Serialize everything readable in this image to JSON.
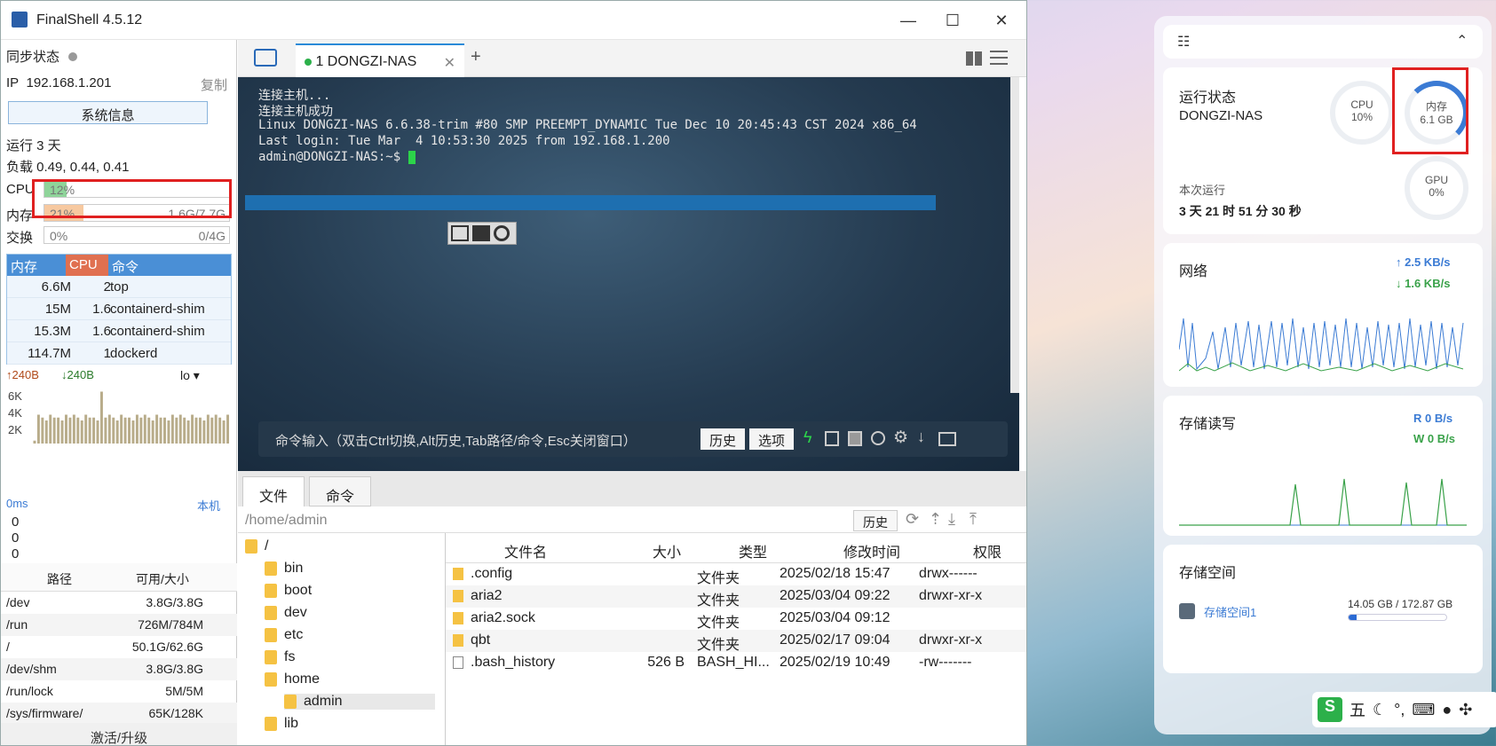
{
  "app": {
    "title": "FinalShell 4.5.12",
    "win_minimize": "—",
    "win_maximize": "☐",
    "win_close": "✕"
  },
  "left": {
    "sync_label": "同步状态",
    "ip_label": "IP",
    "ip": "192.168.1.201",
    "copy": "复制",
    "sysinfo_button": "系统信息",
    "uptime": "运行 3 天",
    "load": "负载 0.49, 0.44, 0.41",
    "cpu_label": "CPU",
    "cpu_pct": "12%",
    "cpu_fraction": 0.12,
    "mem_label": "内存",
    "mem_pct": "21%",
    "mem_fraction": 0.21,
    "mem_val": "1.6G/7.7G",
    "swap_label": "交换",
    "swap_pct": "0%",
    "swap_val": "0/4G",
    "proc_headers": {
      "mem": "内存",
      "cpu": "CPU",
      "cmd": "命令"
    },
    "processes": [
      {
        "mem": "6.6M",
        "cpu": "2",
        "cmd": "top"
      },
      {
        "mem": "15M",
        "cpu": "1.6",
        "cmd": "containerd-shim"
      },
      {
        "mem": "15.3M",
        "cpu": "1.6",
        "cmd": "containerd-shim"
      },
      {
        "mem": "114.7M",
        "cpu": "1",
        "cmd": "dockerd"
      }
    ],
    "net_up": "240B",
    "net_down": "240B",
    "net_iface": "lo",
    "net_axis": [
      "6K",
      "4K",
      "2K"
    ],
    "net_bars": [
      0.05,
      0.5,
      0.45,
      0.4,
      0.5,
      0.45,
      0.45,
      0.4,
      0.5,
      0.45,
      0.5,
      0.45,
      0.4,
      0.5,
      0.45,
      0.45,
      0.4,
      0.9,
      0.45,
      0.5,
      0.45,
      0.4,
      0.5,
      0.45,
      0.45,
      0.4,
      0.5,
      0.45,
      0.5,
      0.45,
      0.4,
      0.5,
      0.45,
      0.45,
      0.4,
      0.5,
      0.45,
      0.5,
      0.45,
      0.4,
      0.5,
      0.45,
      0.45,
      0.4,
      0.5,
      0.45,
      0.5,
      0.45,
      0.4,
      0.5
    ],
    "ping_label": "0ms",
    "ping_host": "本机",
    "ping_vals": [
      "0",
      "0",
      "0"
    ],
    "disk_headers": {
      "path": "路径",
      "avail": "可用/大小"
    },
    "disks": [
      {
        "path": "/dev",
        "size": "3.8G/3.8G"
      },
      {
        "path": "/run",
        "size": "726M/784M"
      },
      {
        "path": "/",
        "size": "50.1G/62.6G"
      },
      {
        "path": "/dev/shm",
        "size": "3.8G/3.8G"
      },
      {
        "path": "/run/lock",
        "size": "5M/5M"
      },
      {
        "path": "/sys/firmware/",
        "size": "65K/128K"
      }
    ],
    "activate": "激活/升级"
  },
  "tabs": {
    "session": "1 DONGZI-NAS",
    "add": "+"
  },
  "terminal": {
    "lines": [
      "连接主机...",
      "连接主机成功",
      "Linux DONGZI-NAS 6.6.38-trim #80 SMP PREEMPT_DYNAMIC Tue Dec 10 20:45:43 CST 2024 x86_64",
      "Last login: Tue Mar  4 10:53:30 2025 from 192.168.1.200",
      "admin@DONGZI-NAS:~$ "
    ],
    "cmd_hint": "命令输入（双击Ctrl切换,Alt历史,Tab路径/命令,Esc关闭窗口）",
    "history_btn": "历史",
    "options_btn": "选项"
  },
  "files": {
    "tab_files": "文件",
    "tab_cmds": "命令",
    "path": "/home/admin",
    "history_btn": "历史",
    "tree": [
      {
        "name": "/",
        "level": 0
      },
      {
        "name": "bin",
        "level": 1
      },
      {
        "name": "boot",
        "level": 1
      },
      {
        "name": "dev",
        "level": 1
      },
      {
        "name": "etc",
        "level": 1
      },
      {
        "name": "fs",
        "level": 1
      },
      {
        "name": "home",
        "level": 1
      },
      {
        "name": "admin",
        "level": 2
      },
      {
        "name": "lib",
        "level": 1
      }
    ],
    "headers": {
      "name": "文件名",
      "size": "大小",
      "type": "类型",
      "mtime": "修改时间",
      "perm": "权限"
    },
    "rows": [
      {
        "name": ".config",
        "size": "",
        "type": "文件夹",
        "mtime": "2025/02/18 15:47",
        "perm": "drwx------"
      },
      {
        "name": "aria2",
        "size": "",
        "type": "文件夹",
        "mtime": "2025/03/04 09:22",
        "perm": "drwxr-xr-x"
      },
      {
        "name": "aria2.sock",
        "size": "",
        "type": "文件夹",
        "mtime": "2025/03/04 09:12",
        "perm": ""
      },
      {
        "name": "qbt",
        "size": "",
        "type": "文件夹",
        "mtime": "2025/02/17 09:04",
        "perm": "drwxr-xr-x"
      },
      {
        "name": ".bash_history",
        "size": "526 B",
        "type": "BASH_HI...",
        "mtime": "2025/02/19 10:49",
        "perm": "-rw-------"
      }
    ]
  },
  "widgets": {
    "status": {
      "title": "运行状态",
      "host": "DONGZI-NAS",
      "cpu_label": "CPU",
      "cpu": "10%",
      "cpu_fraction": 0.1,
      "mem_label": "内存",
      "mem": "6.1 GB",
      "mem_fraction": 0.35,
      "gpu_label": "GPU",
      "gpu": "0%",
      "uptime_label": "本次运行",
      "uptime": "3 天 21 时 51 分 30 秒"
    },
    "network": {
      "title": "网络",
      "up": "2.5 KB/s",
      "down": "1.6 KB/s"
    },
    "diskio": {
      "title": "存储读写",
      "read": "R  0 B/s",
      "write": "W  0 B/s"
    },
    "storage": {
      "title": "存储空间",
      "name": "存储空间1",
      "usage": "14.05 GB / 172.87 GB",
      "fraction": 0.08
    }
  },
  "ime": {
    "mode": "五",
    "punct": "°,"
  },
  "colors": {
    "cpu_fill": "#8fd49a",
    "mem_fill": "#f7c9a0",
    "proc_header": "#4a8fd6",
    "proc_cpu_header": "#e07050",
    "highlight": "#e02020",
    "accent": "#3b7bd4"
  }
}
